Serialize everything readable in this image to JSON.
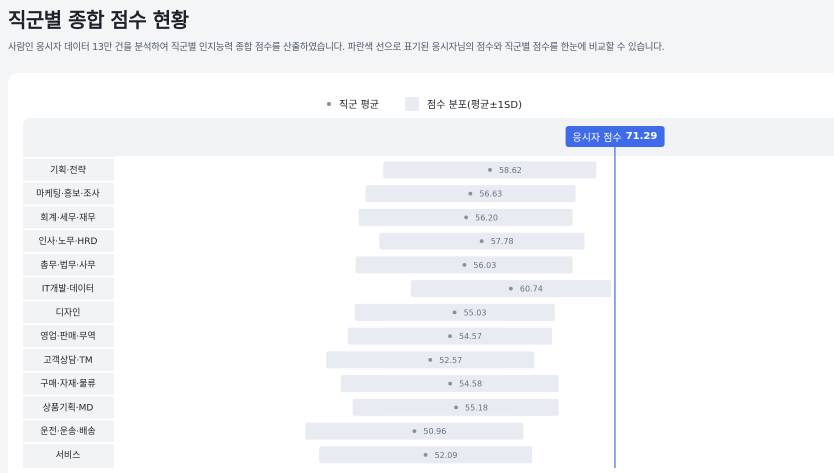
{
  "page": {
    "title": "직군별 종합 점수 현황",
    "description": "사람인 응시자 데이터 13만 건을 분석하여 직군별 인지능력 종합 점수를 산출하였습니다. 파란색 선으로 표기된 응시자님의 점수와 직군별 점수를 한눈에 비교할 수 있습니다."
  },
  "legend": {
    "mean_label": "직군 평균",
    "band_label": "점수 분포(평균±1SD)"
  },
  "marker": {
    "label": "응시자 점수",
    "value": 71.29,
    "color": "#3f6be8"
  },
  "colors": {
    "band": "#e8ebf2",
    "mean_dot": "#8a8f99",
    "marker_line": "#3f6be8"
  },
  "chart_data": {
    "type": "range-bar",
    "orientation": "horizontal",
    "x_range": [
      20.5,
      93.5
    ],
    "categories": [
      "기획·전략",
      "마케팅·홍보·조사",
      "회계·세무·재무",
      "인사·노무·HRD",
      "총무·법무·사무",
      "IT개발·데이터",
      "디자인",
      "영업·판매·무역",
      "고객상담·TM",
      "구매·자재·물류",
      "상품기획·MD",
      "운전·운송·배송",
      "서비스"
    ],
    "series": [
      {
        "name": "직군 평균",
        "values": [
          58.62,
          56.63,
          56.2,
          57.78,
          56.03,
          60.74,
          55.03,
          54.57,
          52.57,
          54.58,
          55.18,
          50.96,
          52.09
        ]
      },
      {
        "name": "점수 분포(평균±1SD)",
        "low": [
          47.8,
          46.0,
          45.3,
          47.4,
          45.0,
          50.6,
          44.9,
          44.2,
          42.0,
          43.5,
          44.7,
          39.9,
          41.3
        ],
        "high": [
          69.4,
          67.3,
          67.0,
          68.2,
          67.0,
          70.9,
          65.2,
          64.9,
          63.1,
          65.6,
          65.6,
          62.0,
          62.9
        ]
      }
    ],
    "reference_line": {
      "name": "응시자 점수",
      "value": 71.29
    }
  }
}
